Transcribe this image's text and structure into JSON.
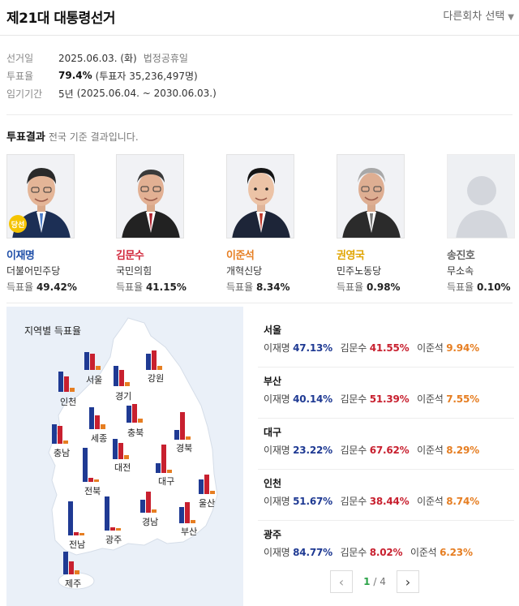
{
  "header": {
    "title": "제21대 대통령선거",
    "round_select": "다른회차 선택"
  },
  "info": {
    "date_label": "선거일",
    "date_value": "2025.06.03. (화)",
    "date_note": "법정공휴일",
    "turnout_label": "투표율",
    "turnout_value": "79.4%",
    "turnout_note": "(투표자 35,236,497명)",
    "term_label": "임기기간",
    "term_value": "5년",
    "term_note": "(2025.06.04. ~ 2030.06.03.)"
  },
  "results_head": {
    "title": "투표결과",
    "note": "전국 기준 결과입니다."
  },
  "rate_label": "득표율",
  "elected_badge": "당선",
  "candidates": [
    {
      "name": "이재명",
      "party": "더불어민주당",
      "rate": "49.42%",
      "color": "#1f4fa8"
    },
    {
      "name": "김문수",
      "party": "국민의힘",
      "rate": "41.15%",
      "color": "#d1263a"
    },
    {
      "name": "이준석",
      "party": "개혁신당",
      "rate": "8.34%",
      "color": "#e67e22"
    },
    {
      "name": "권영국",
      "party": "민주노동당",
      "rate": "0.98%",
      "color": "#e0a400"
    },
    {
      "name": "송진호",
      "party": "무소속",
      "rate": "0.10%",
      "color": "#666666"
    }
  ],
  "map": {
    "title": "지역별 득표율",
    "regions": [
      "서울",
      "경기",
      "강원",
      "인천",
      "충북",
      "세종",
      "충남",
      "대전",
      "경북",
      "대구",
      "전북",
      "울산",
      "경남",
      "광주",
      "부산",
      "전남",
      "제주"
    ]
  },
  "list": [
    {
      "region": "서울",
      "c1": "이재명",
      "v1": "47.13%",
      "c2": "김문수",
      "v2": "41.55%",
      "c3": "이준석",
      "v3": "9.94%"
    },
    {
      "region": "부산",
      "c1": "이재명",
      "v1": "40.14%",
      "c2": "김문수",
      "v2": "51.39%",
      "c3": "이준석",
      "v3": "7.55%"
    },
    {
      "region": "대구",
      "c1": "이재명",
      "v1": "23.22%",
      "c2": "김문수",
      "v2": "67.62%",
      "c3": "이준석",
      "v3": "8.29%"
    },
    {
      "region": "인천",
      "c1": "이재명",
      "v1": "51.67%",
      "c2": "김문수",
      "v2": "38.44%",
      "c3": "이준석",
      "v3": "8.74%"
    },
    {
      "region": "광주",
      "c1": "이재명",
      "v1": "84.77%",
      "c2": "김문수",
      "v2": "8.02%",
      "c3": "이준석",
      "v3": "6.23%"
    }
  ],
  "pager": {
    "current": "1",
    "total": "4",
    "separator": "/"
  },
  "colors": {
    "c1": "#1f3a93",
    "c2": "#c8202f",
    "c3": "#e67e22",
    "map_bg": "#eaf0f8",
    "land": "#ffffff"
  },
  "icons": [
    "chevron-down-icon",
    "chevron-left-icon",
    "chevron-right-icon",
    "elected-badge-icon"
  ]
}
